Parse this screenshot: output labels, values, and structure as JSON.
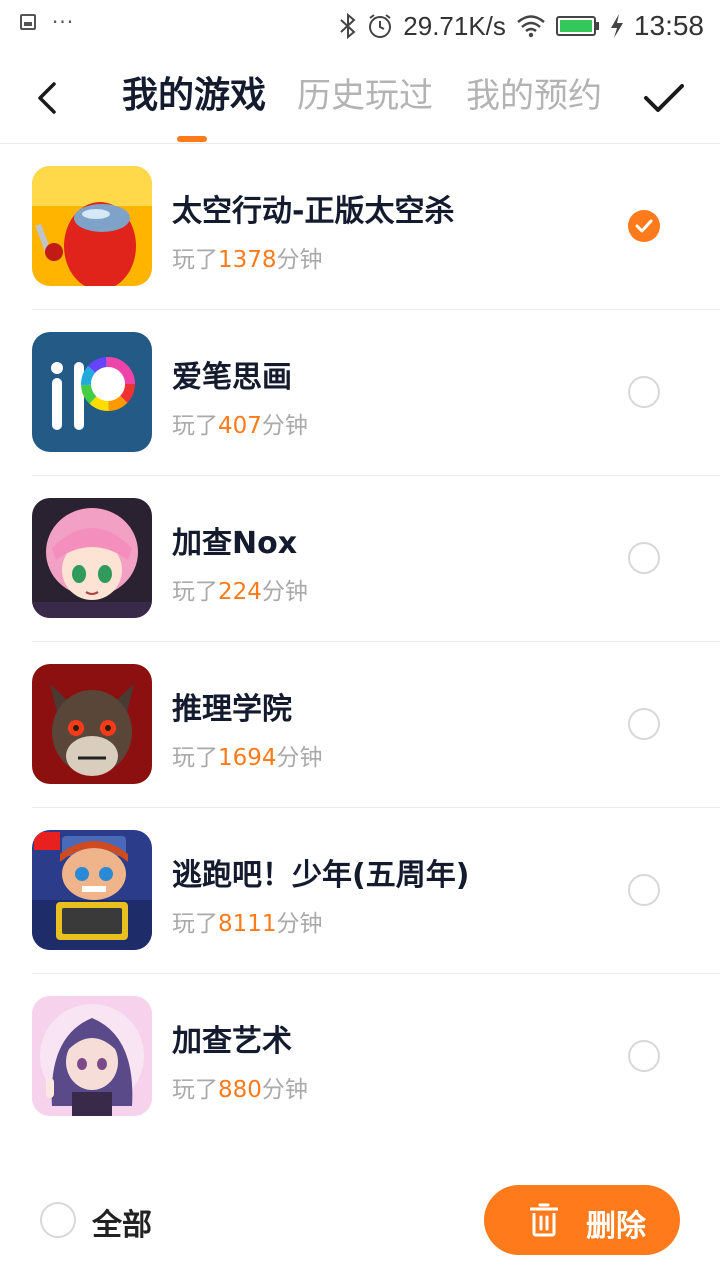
{
  "status_bar": {
    "speed": "29.71K/s",
    "time": "13:58",
    "icons": [
      "image-icon",
      "more-dots-icon",
      "bluetooth-icon",
      "alarm-icon",
      "wifi-icon",
      "battery-icon",
      "charging-icon"
    ]
  },
  "header": {
    "tabs": [
      {
        "label": "我的游戏",
        "active": true
      },
      {
        "label": "历史玩过",
        "active": false
      },
      {
        "label": "我的预约",
        "active": false
      }
    ]
  },
  "games": [
    {
      "name": "太空行动-正版太空杀",
      "played_prefix": "玩了",
      "minutes": "1378",
      "played_suffix": "分钟",
      "selected": true,
      "icon": "space-action-icon"
    },
    {
      "name": "爱笔思画",
      "played_prefix": "玩了",
      "minutes": "407",
      "played_suffix": "分钟",
      "selected": false,
      "icon": "ibis-paint-icon"
    },
    {
      "name": "加查Nox",
      "played_prefix": "玩了",
      "minutes": "224",
      "played_suffix": "分钟",
      "selected": false,
      "icon": "gacha-nox-icon"
    },
    {
      "name": "推理学院",
      "played_prefix": "玩了",
      "minutes": "1694",
      "played_suffix": "分钟",
      "selected": false,
      "icon": "reasoning-academy-icon"
    },
    {
      "name": "逃跑吧！少年(五周年)",
      "played_prefix": "玩了",
      "minutes": "8111",
      "played_suffix": "分钟",
      "selected": false,
      "icon": "run-boy-icon"
    },
    {
      "name": "加查艺术",
      "played_prefix": "玩了",
      "minutes": "880",
      "played_suffix": "分钟",
      "selected": false,
      "icon": "gacha-art-icon"
    }
  ],
  "bottom_bar": {
    "select_all_label": "全部",
    "delete_label": "删除"
  },
  "colors": {
    "accent": "#ff7a1a",
    "title": "#151b2e",
    "muted": "#aaaaaa"
  }
}
